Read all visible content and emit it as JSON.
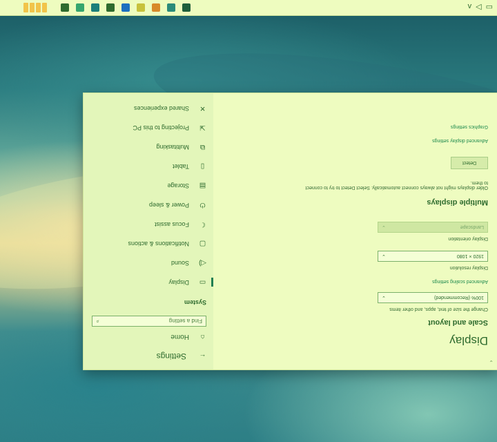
{
  "taskbar": {
    "icons": [
      {
        "name": "settings-gear-icon",
        "color": "#2f6b2e"
      },
      {
        "name": "store-icon",
        "color": "#36a66e"
      },
      {
        "name": "edge-icon",
        "color": "#1c7f7a"
      },
      {
        "name": "folder-icon",
        "color": "#2f6b2e"
      },
      {
        "name": "vscode-icon",
        "color": "#1d6fbf"
      },
      {
        "name": "app-icon",
        "color": "#c7c23c"
      },
      {
        "name": "firefox-icon",
        "color": "#d88a2a"
      },
      {
        "name": "photos-icon",
        "color": "#2b8c7a"
      },
      {
        "name": "terminal-icon",
        "color": "#1f5f3a"
      }
    ],
    "tray": [
      "v",
      "◁",
      "▭"
    ]
  },
  "nav": {
    "back_label": "Settings",
    "home_label": "Home",
    "search_placeholder": "Find a setting",
    "section": "System",
    "items": [
      {
        "label": "Display",
        "icon": "monitor-icon",
        "active": true
      },
      {
        "label": "Sound",
        "icon": "speaker-icon",
        "active": false
      },
      {
        "label": "Notifications & actions",
        "icon": "notification-icon",
        "active": false
      },
      {
        "label": "Focus assist",
        "icon": "moon-icon",
        "active": false
      },
      {
        "label": "Power & sleep",
        "icon": "power-icon",
        "active": false
      },
      {
        "label": "Storage",
        "icon": "storage-icon",
        "active": false
      },
      {
        "label": "Tablet",
        "icon": "tablet-icon",
        "active": false
      },
      {
        "label": "Multitasking",
        "icon": "multitasking-icon",
        "active": false
      },
      {
        "label": "Projecting to this PC",
        "icon": "projecting-icon",
        "active": false
      },
      {
        "label": "Shared experiences",
        "icon": "shared-icon",
        "active": false
      }
    ]
  },
  "content": {
    "title": "Display",
    "scale_heading": "Scale and layout",
    "scale_desc": "Change the size of text, apps, and other items",
    "scale_value": "100% (Recommended)",
    "advanced_scaling_link": "Advanced scaling settings",
    "resolution_label": "Display resolution",
    "resolution_value": "1920 × 1080",
    "orientation_label": "Display orientation",
    "orientation_value": "Landscape",
    "multiple_heading": "Multiple displays",
    "multiple_desc": "Older displays might not always connect automatically. Select Detect to try to connect to them.",
    "detect_button": "Detect",
    "advanced_display_link": "Advanced display settings",
    "graphics_link": "Graphics settings"
  }
}
